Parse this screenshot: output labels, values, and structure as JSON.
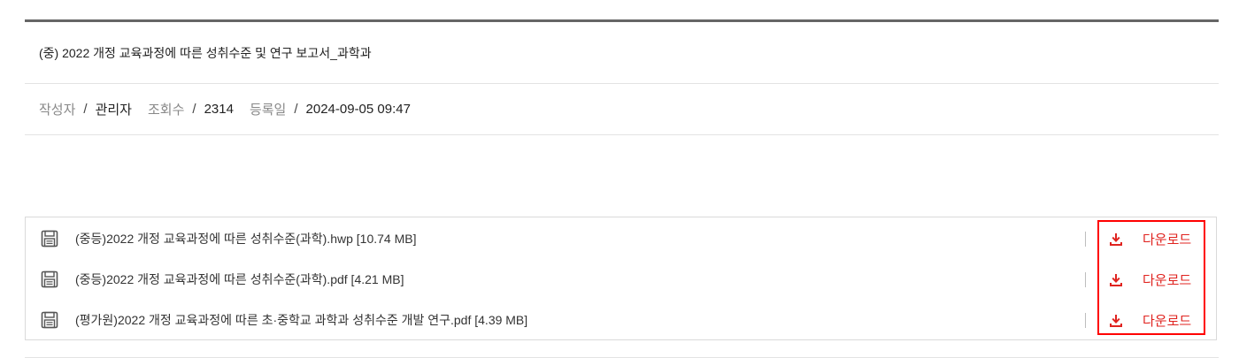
{
  "post": {
    "title": "(중) 2022 개정 교육과정에 따른 성취수준 및 연구 보고서_과학과",
    "meta": {
      "author_label": "작성자",
      "author": "관리자",
      "views_label": "조회수",
      "views": "2314",
      "date_label": "등록일",
      "date": "2024-09-05 09:47",
      "separator": "/"
    }
  },
  "attachments": [
    {
      "name": "(중등)2022 개정 교육과정에 따른 성취수준(과학).hwp [10.74 MB]",
      "download_label": "다운로드"
    },
    {
      "name": "(중등)2022 개정 교육과정에 따른 성취수준(과학).pdf [4.21 MB]",
      "download_label": "다운로드"
    },
    {
      "name": "(평가원)2022 개정 교육과정에 따른 초·중학교 과학과 성취수준 개발 연구.pdf [4.39 MB]",
      "download_label": "다운로드"
    }
  ],
  "colors": {
    "accent": "#e0231f",
    "highlight": "#ff0000"
  }
}
